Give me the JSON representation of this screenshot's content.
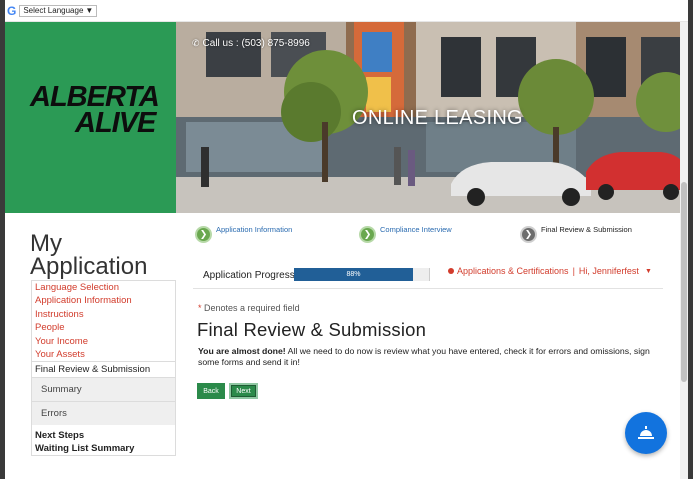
{
  "translate": {
    "g_glyph": "G",
    "label": "Select Language",
    "caret": "▼"
  },
  "logo": {
    "line1": "ALBERTA",
    "line2": "ALIVE"
  },
  "hero": {
    "phone_icon": "phone-icon",
    "phone": "Call us : (503) 875-8996",
    "title": "ONLINE LEASING"
  },
  "sidebar": {
    "title_line1": "My",
    "title_line2": "Application",
    "links": [
      "Language Selection",
      "Application Information",
      "Instructions",
      "People",
      "Your Income",
      "Your Assets"
    ],
    "active": "Final Review & Submission",
    "subitems": [
      "Summary",
      "Errors"
    ],
    "plain": [
      "Next Steps",
      "Waiting List Summary"
    ]
  },
  "steps": [
    {
      "label": "Application Information",
      "status": "done"
    },
    {
      "label": "Compliance Interview",
      "status": "done"
    },
    {
      "label": "Final Review & Submission",
      "status": "current"
    }
  ],
  "progress": {
    "label": "Application Progress",
    "value": 88,
    "text": "88%"
  },
  "menu": {
    "apps": "Applications & Certifications",
    "separator": "|",
    "user": "Hi, Jenniferfest",
    "caret": "▼"
  },
  "content": {
    "required_star": "*",
    "required_text": " Denotes a required field",
    "heading": "Final Review & Submission",
    "intro_strong": "You are almost done!",
    "intro_rest": " All we need to do now is review what you have entered, check it for errors and omissions, sign some forms and send it in!"
  },
  "buttons": {
    "back": "Back",
    "next": "Next"
  },
  "colors": {
    "brand_green": "#2b9a55",
    "link_red": "#d23c2c",
    "progress_blue": "#215f97",
    "button_green": "#2b8a4a",
    "chat_blue": "#1273de"
  }
}
